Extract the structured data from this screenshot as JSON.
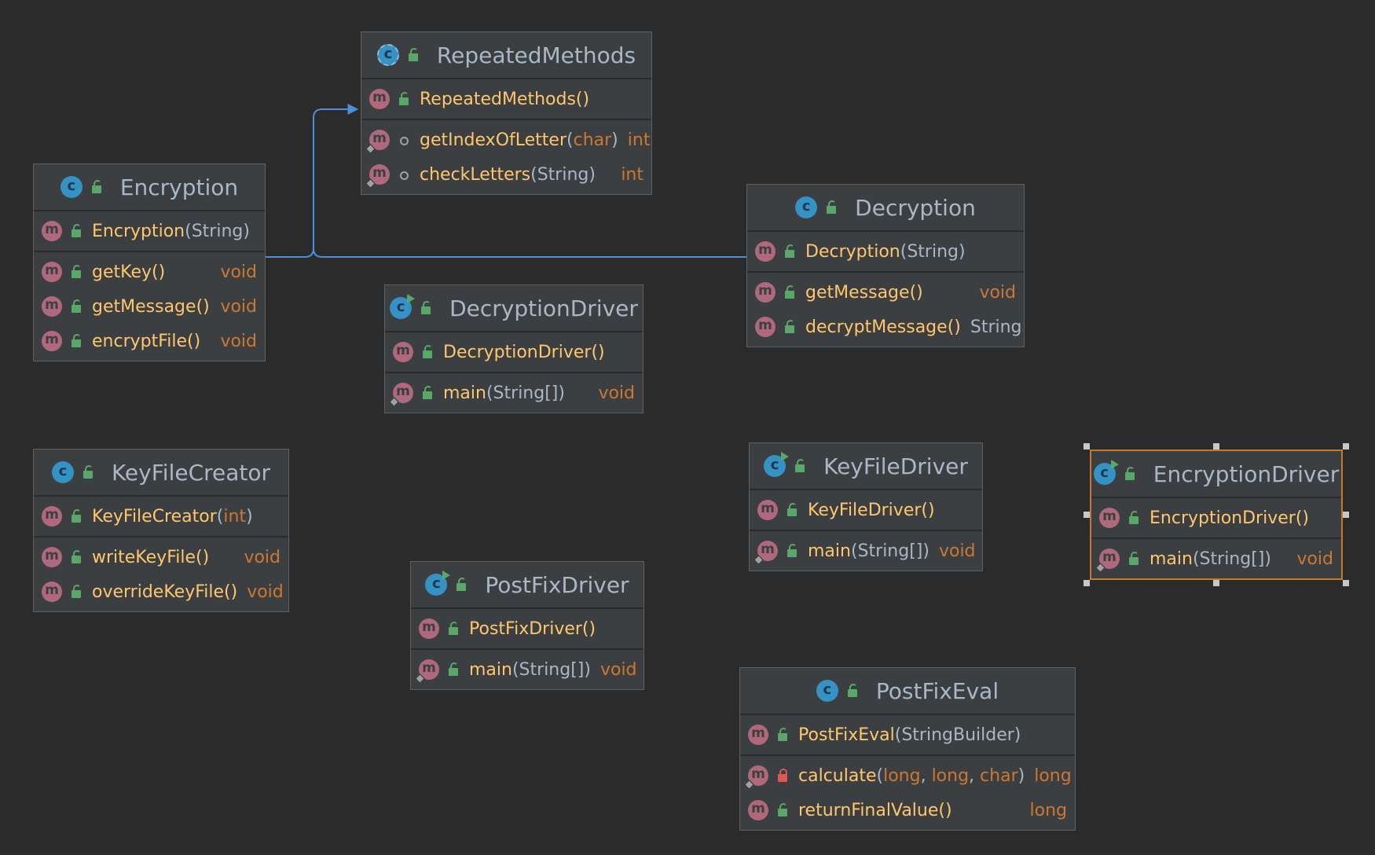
{
  "diagram": {
    "classes": [
      {
        "id": "repeatedmethods",
        "name": "RepeatedMethods",
        "icon": "abstract-class-icon",
        "run": false,
        "selected": false,
        "sections": [
          [
            {
              "name": "RepeatedMethods",
              "params": [
                {
                  "t": "()",
                  "k": false
                }
              ],
              "ret": "",
              "vis": "public",
              "static": false
            }
          ],
          [
            {
              "name": "getIndexOfLetter",
              "params": [
                {
                  "t": "(",
                  "k": false
                },
                {
                  "t": "char",
                  "k": true
                },
                {
                  "t": ")",
                  "k": false
                }
              ],
              "ret": "int",
              "vis": "package",
              "static": true
            },
            {
              "name": "checkLetters",
              "params": [
                {
                  "t": "(String)",
                  "k": false
                }
              ],
              "ret": "int",
              "vis": "package",
              "static": true
            }
          ]
        ]
      },
      {
        "id": "encryption",
        "name": "Encryption",
        "icon": "class-icon",
        "run": false,
        "selected": false,
        "sections": [
          [
            {
              "name": "Encryption",
              "params": [
                {
                  "t": "(String)",
                  "k": false
                }
              ],
              "ret": "",
              "vis": "public",
              "static": false
            }
          ],
          [
            {
              "name": "getKey",
              "params": [
                {
                  "t": "()",
                  "k": false
                }
              ],
              "ret": "void",
              "vis": "public",
              "static": false
            },
            {
              "name": "getMessage",
              "params": [
                {
                  "t": "()",
                  "k": false
                }
              ],
              "ret": "void",
              "vis": "public",
              "static": false
            },
            {
              "name": "encryptFile",
              "params": [
                {
                  "t": "()",
                  "k": false
                }
              ],
              "ret": "void",
              "vis": "public",
              "static": false
            }
          ]
        ]
      },
      {
        "id": "decryption",
        "name": "Decryption",
        "icon": "class-icon",
        "run": false,
        "selected": false,
        "sections": [
          [
            {
              "name": "Decryption",
              "params": [
                {
                  "t": "(String)",
                  "k": false
                }
              ],
              "ret": "",
              "vis": "public",
              "static": false
            }
          ],
          [
            {
              "name": "getMessage",
              "params": [
                {
                  "t": "()",
                  "k": false
                }
              ],
              "ret": "void",
              "vis": "public",
              "static": false
            },
            {
              "name": "decryptMessage",
              "params": [
                {
                  "t": "()",
                  "k": false
                }
              ],
              "ret": "String",
              "retObj": true,
              "vis": "public",
              "static": false
            }
          ]
        ]
      },
      {
        "id": "decryptiondriver",
        "name": "DecryptionDriver",
        "icon": "runnable-class-icon",
        "run": true,
        "selected": false,
        "sections": [
          [
            {
              "name": "DecryptionDriver",
              "params": [
                {
                  "t": "()",
                  "k": false
                }
              ],
              "ret": "",
              "vis": "public",
              "static": false
            }
          ],
          [
            {
              "name": "main",
              "params": [
                {
                  "t": "(String[])",
                  "k": false
                }
              ],
              "ret": "void",
              "vis": "public",
              "static": true
            }
          ]
        ]
      },
      {
        "id": "keyfilecreator",
        "name": "KeyFileCreator",
        "icon": "class-icon",
        "run": false,
        "selected": false,
        "sections": [
          [
            {
              "name": "KeyFileCreator",
              "params": [
                {
                  "t": "(",
                  "k": false
                },
                {
                  "t": "int",
                  "k": true
                },
                {
                  "t": ")",
                  "k": false
                }
              ],
              "ret": "",
              "vis": "public",
              "static": false
            }
          ],
          [
            {
              "name": "writeKeyFile",
              "params": [
                {
                  "t": "()",
                  "k": false
                }
              ],
              "ret": "void",
              "vis": "public",
              "static": false
            },
            {
              "name": "overrideKeyFile",
              "params": [
                {
                  "t": "()",
                  "k": false
                }
              ],
              "ret": "void",
              "vis": "public",
              "static": false
            }
          ]
        ]
      },
      {
        "id": "keyfiledriver",
        "name": "KeyFileDriver",
        "icon": "runnable-class-icon",
        "run": true,
        "selected": false,
        "sections": [
          [
            {
              "name": "KeyFileDriver",
              "params": [
                {
                  "t": "()",
                  "k": false
                }
              ],
              "ret": "",
              "vis": "public",
              "static": false
            }
          ],
          [
            {
              "name": "main",
              "params": [
                {
                  "t": "(String[])",
                  "k": false
                }
              ],
              "ret": "void",
              "vis": "public",
              "static": true
            }
          ]
        ]
      },
      {
        "id": "encryptiondriver",
        "name": "EncryptionDriver",
        "icon": "runnable-class-icon",
        "run": true,
        "selected": true,
        "sections": [
          [
            {
              "name": "EncryptionDriver",
              "params": [
                {
                  "t": "()",
                  "k": false
                }
              ],
              "ret": "",
              "vis": "public",
              "static": false
            }
          ],
          [
            {
              "name": "main",
              "params": [
                {
                  "t": "(String[])",
                  "k": false
                }
              ],
              "ret": "void",
              "vis": "public",
              "static": true
            }
          ]
        ]
      },
      {
        "id": "postfixdriver",
        "name": "PostFixDriver",
        "icon": "runnable-class-icon",
        "run": true,
        "selected": false,
        "sections": [
          [
            {
              "name": "PostFixDriver",
              "params": [
                {
                  "t": "()",
                  "k": false
                }
              ],
              "ret": "",
              "vis": "public",
              "static": false
            }
          ],
          [
            {
              "name": "main",
              "params": [
                {
                  "t": "(String[])",
                  "k": false
                }
              ],
              "ret": "void",
              "vis": "public",
              "static": true
            }
          ]
        ]
      },
      {
        "id": "postfixeval",
        "name": "PostFixEval",
        "icon": "class-icon",
        "run": false,
        "selected": false,
        "sections": [
          [
            {
              "name": "PostFixEval",
              "params": [
                {
                  "t": "(StringBuilder)",
                  "k": false
                }
              ],
              "ret": "",
              "vis": "public",
              "static": false
            }
          ],
          [
            {
              "name": "calculate",
              "params": [
                {
                  "t": "(",
                  "k": false
                },
                {
                  "t": "long",
                  "k": true
                },
                {
                  "t": ", ",
                  "k": false
                },
                {
                  "t": "long",
                  "k": true
                },
                {
                  "t": ", ",
                  "k": false
                },
                {
                  "t": "char",
                  "k": true
                },
                {
                  "t": ")",
                  "k": false
                }
              ],
              "ret": "long",
              "vis": "private",
              "static": true
            },
            {
              "name": "returnFinalValue",
              "params": [
                {
                  "t": "()",
                  "k": false
                }
              ],
              "ret": "long",
              "vis": "public",
              "static": false
            }
          ]
        ]
      }
    ],
    "edges": [
      {
        "from": "encryption",
        "to": "repeatedmethods",
        "kind": "inheritance"
      },
      {
        "from": "decryption",
        "to": "repeatedmethods",
        "kind": "inheritance"
      }
    ],
    "colors": {
      "background": "#2b2b2b",
      "node": "#3c3f41",
      "method": "#ffc66d",
      "keyword": "#cc7832",
      "edge": "#4a8fdc",
      "selection": "#c7782f"
    }
  }
}
